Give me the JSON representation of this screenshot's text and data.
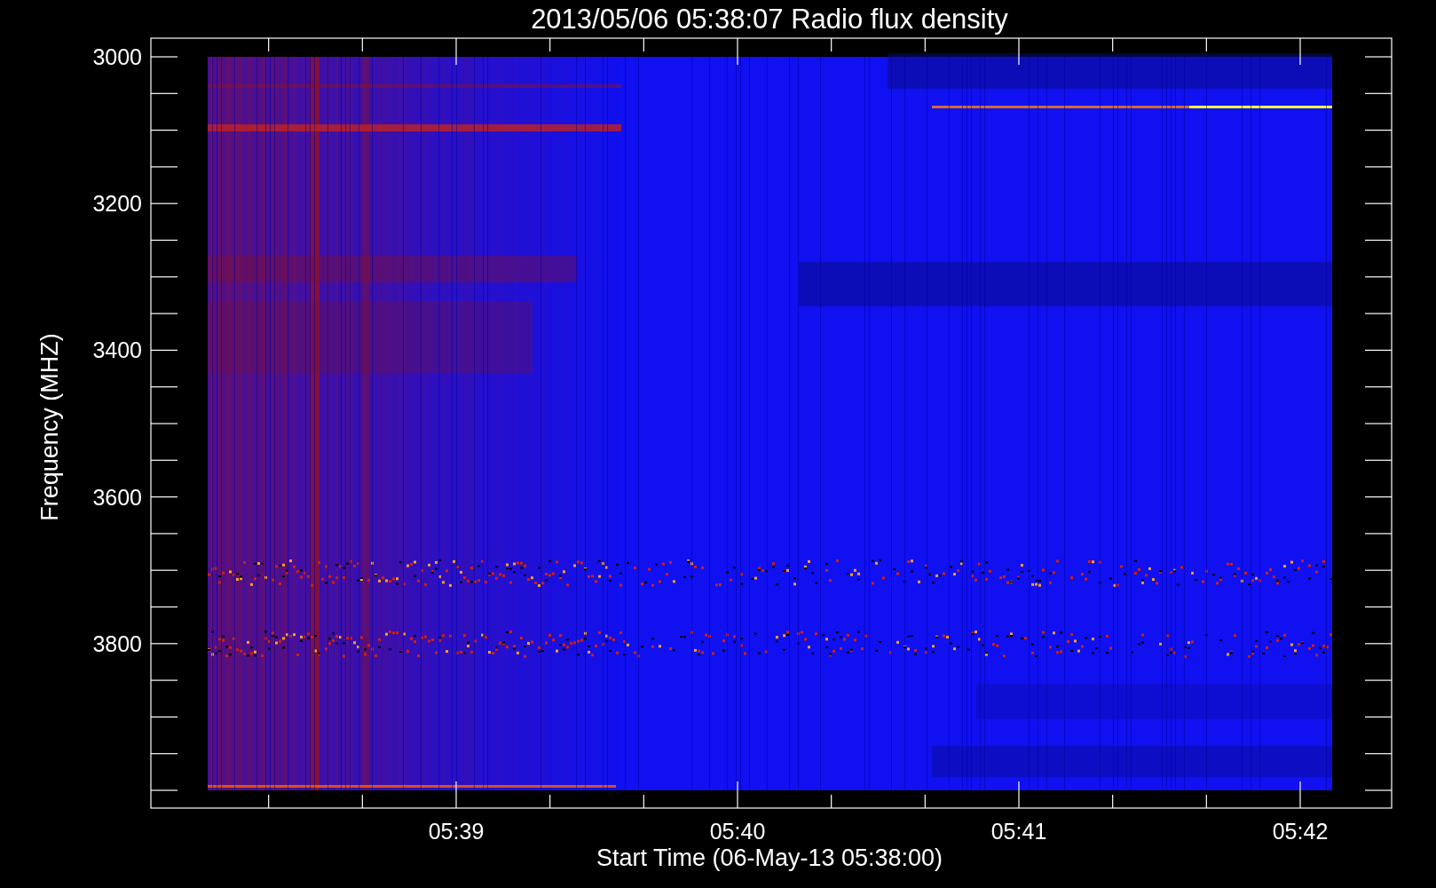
{
  "title": "2013/05/06 05:38:07 Radio flux density",
  "plot": {
    "ylabel": "Frequency (MHZ)",
    "xlabel": "Start Time (06-May-13 05:38:00)",
    "y_tick_labels": [
      "3000",
      "3200",
      "3400",
      "3600",
      "3800"
    ],
    "x_tick_labels": [
      "05:39",
      "05:40",
      "05:41",
      "05:42"
    ]
  }
}
